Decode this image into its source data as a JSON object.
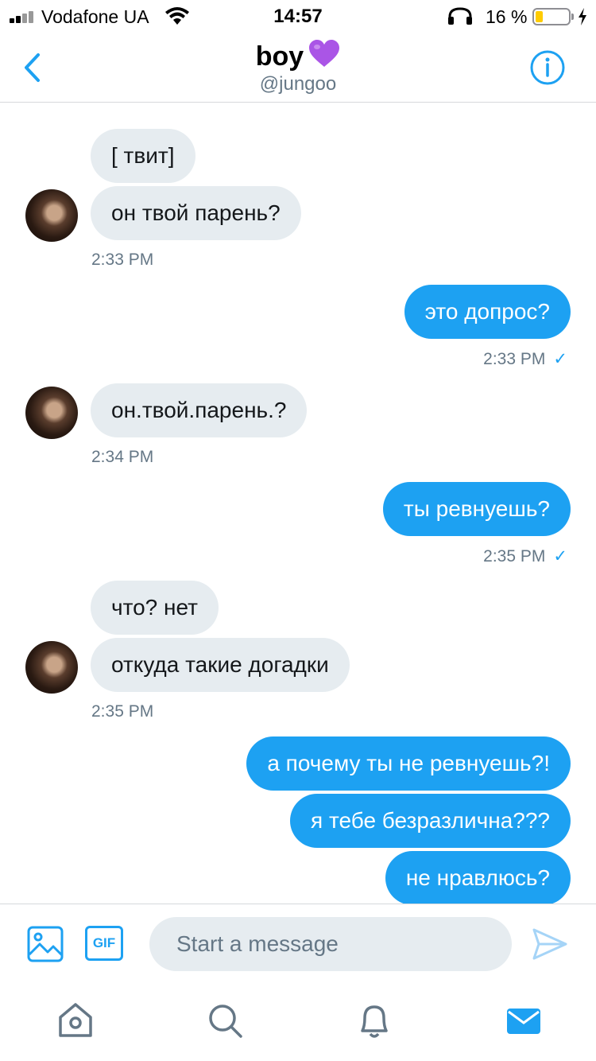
{
  "status_bar": {
    "carrier": "Vodafone UA",
    "time": "14:57",
    "battery_percent": "16 %",
    "battery_level": 0.16,
    "signal_icon": "signal-bars-icon",
    "wifi_icon": "wifi-icon",
    "headphones_icon": "headphones-icon",
    "charging_icon": "charging-bolt-icon"
  },
  "header": {
    "name": "boy",
    "emoji": "💜",
    "handle": "@jungoo",
    "back_icon": "chevron-left-icon",
    "info_icon": "info-icon"
  },
  "conversation": {
    "received_1": [
      "[ твит]",
      "он твой парень?"
    ],
    "received_1_time": "2:33 PM",
    "sent_1": [
      "это допрос?"
    ],
    "sent_1_time": "2:33 PM",
    "received_2": [
      "он.твой.парень.?"
    ],
    "received_2_time": "2:34 PM",
    "sent_2": [
      "ты ревнуешь?"
    ],
    "sent_2_time": "2:35 PM",
    "received_3": [
      "что? нет",
      "откуда такие догадки"
    ],
    "received_3_time": "2:35 PM",
    "sent_3": [
      "а почему ты не ревнуешь?!",
      "я тебе безразлична???",
      "не нравлюсь?"
    ],
    "read_check": "✓"
  },
  "composer": {
    "placeholder": "Start a message",
    "gif_label": "GIF",
    "media_icon": "image-icon",
    "send_icon": "send-icon"
  },
  "tabs": [
    {
      "icon": "home-icon",
      "active": false
    },
    {
      "icon": "search-icon",
      "active": false
    },
    {
      "icon": "bell-icon",
      "active": false
    },
    {
      "icon": "mail-icon",
      "active": true
    }
  ],
  "colors": {
    "accent": "#1da1f2",
    "received_bubble": "#e6ecf0",
    "muted_text": "#657786",
    "battery_fill": "#ffcc00"
  }
}
